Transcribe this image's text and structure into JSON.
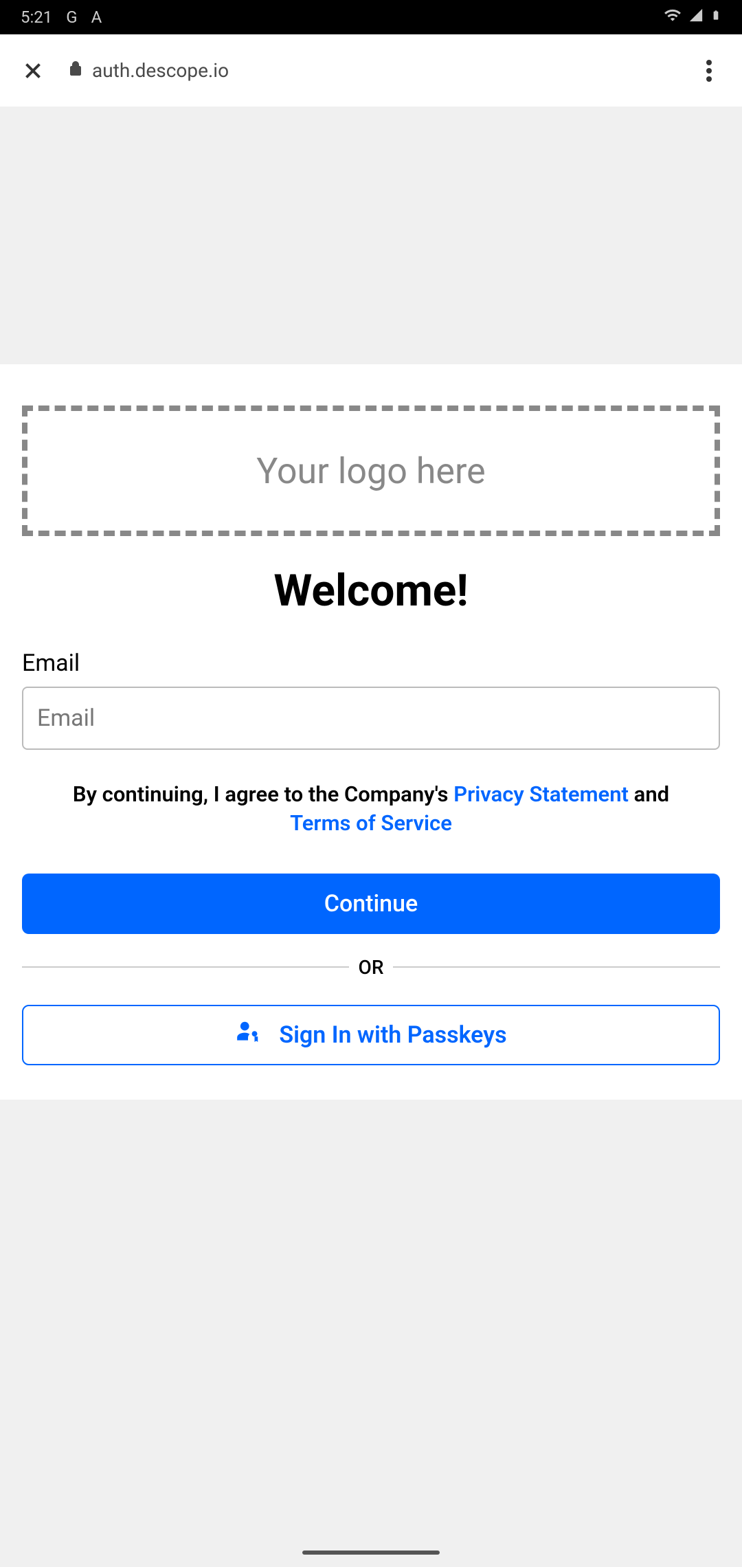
{
  "status_bar": {
    "time": "5:21",
    "left_icons": [
      "G",
      "A"
    ]
  },
  "browser": {
    "url": "auth.descope.io"
  },
  "logo": {
    "placeholder_text": "Your logo here"
  },
  "welcome_title": "Welcome!",
  "email": {
    "label": "Email",
    "placeholder": "Email",
    "value": ""
  },
  "consent": {
    "prefix": "By continuing, I agree to the Company's",
    "privacy_link": "Privacy Statement",
    "and": "and",
    "terms_link": "Terms of Service"
  },
  "continue_button": "Continue",
  "divider_text": "OR",
  "passkey_button": "Sign In with Passkeys",
  "colors": {
    "primary_blue": "#0066ff",
    "placeholder_gray": "#888",
    "border_gray": "#bbb"
  }
}
